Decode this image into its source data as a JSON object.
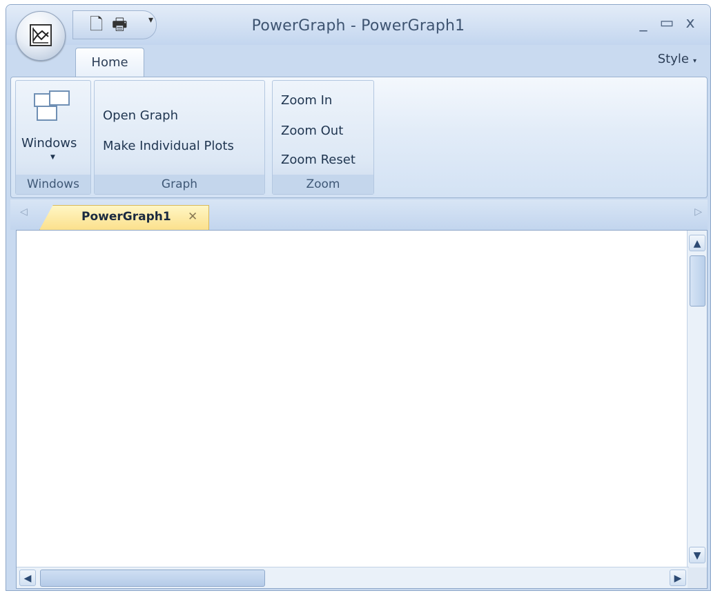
{
  "window": {
    "title": "PowerGraph - PowerGraph1",
    "controls": {
      "minimize": "_",
      "maximize": "▭",
      "close": "x"
    }
  },
  "quick_access": {
    "icons": [
      "new-document-icon",
      "print-icon"
    ],
    "more_glyph": "▾"
  },
  "ribbon": {
    "tabs": [
      {
        "label": "Home",
        "selected": true
      }
    ],
    "style_menu": "Style",
    "groups": [
      {
        "name": "Windows",
        "buttons": [
          {
            "label": "Windows",
            "icon": "windows-icon",
            "has_dropdown": true
          }
        ]
      },
      {
        "name": "Graph",
        "buttons": [
          {
            "label": "Open Graph"
          },
          {
            "label": "Make Individual Plots"
          }
        ]
      },
      {
        "name": "Zoom",
        "buttons": [
          {
            "label": "Zoom In"
          },
          {
            "label": "Zoom Out"
          },
          {
            "label": "Zoom Reset"
          }
        ]
      }
    ]
  },
  "documents": {
    "tabs": [
      {
        "label": "PowerGraph1",
        "active": true,
        "close_glyph": "✕"
      }
    ],
    "nav_left": "◁",
    "nav_right": "▷"
  },
  "scrollbars": {
    "up": "▲",
    "down": "▼",
    "left": "◀",
    "right": "▶"
  },
  "colors": {
    "frame": "#c9daf0",
    "active_tab": "#fbe08c",
    "text": "#1f3550"
  }
}
